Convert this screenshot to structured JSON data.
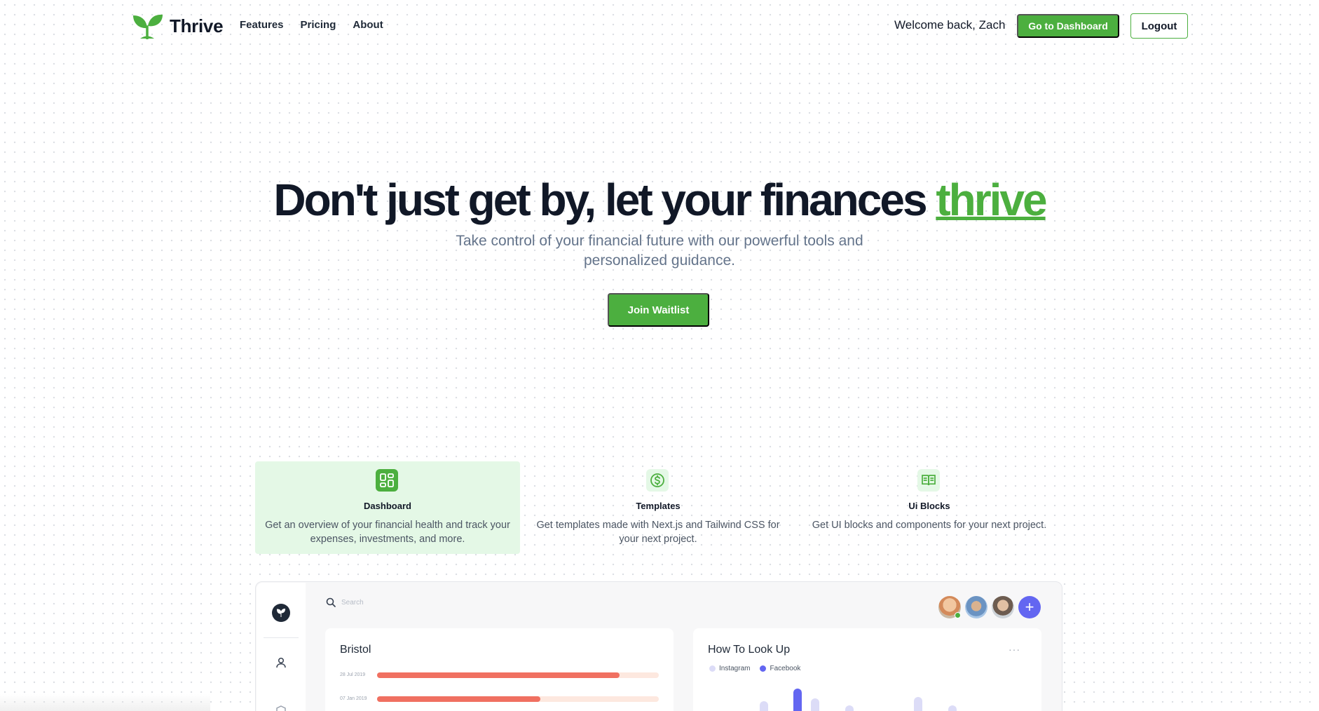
{
  "brand": {
    "name": "Thrive",
    "color": "#4caf3f"
  },
  "nav": {
    "links": [
      "Features",
      "Pricing",
      "About"
    ],
    "welcome": "Welcome back, Zach",
    "dashboard_button": "Go to Dashboard",
    "logout_button": "Logout"
  },
  "hero": {
    "title_main": "Don't just get by, let your finances ",
    "title_accent": "thrive",
    "subtitle": "Take control of your financial future with our powerful tools and personalized guidance.",
    "cta": "Join Waitlist"
  },
  "features": [
    {
      "title": "Dashboard",
      "description": "Get an overview of your financial health and track your expenses, investments, and more.",
      "icon": "dashboard-grid-icon",
      "active": true
    },
    {
      "title": "Templates",
      "description": "Get templates made with Next.js and Tailwind CSS for your next project.",
      "icon": "dollar-circle-icon",
      "active": false
    },
    {
      "title": "Ui Blocks",
      "description": "Get UI blocks and components for your next project.",
      "icon": "book-open-icon",
      "active": false
    }
  ],
  "preview": {
    "search_placeholder": "Search",
    "add_button": "+",
    "card_left": {
      "title": "Bristol",
      "rows": [
        {
          "date": "28 Jul 2019",
          "progress": 0.86
        },
        {
          "date": "07 Jan 2019",
          "progress": 0.58
        }
      ]
    },
    "card_right": {
      "title": "How To Look Up",
      "more": "···",
      "legend": [
        {
          "name": "Instagram",
          "color": "#dcdcf7"
        },
        {
          "name": "Facebook",
          "color": "#6366f1"
        }
      ]
    }
  }
}
